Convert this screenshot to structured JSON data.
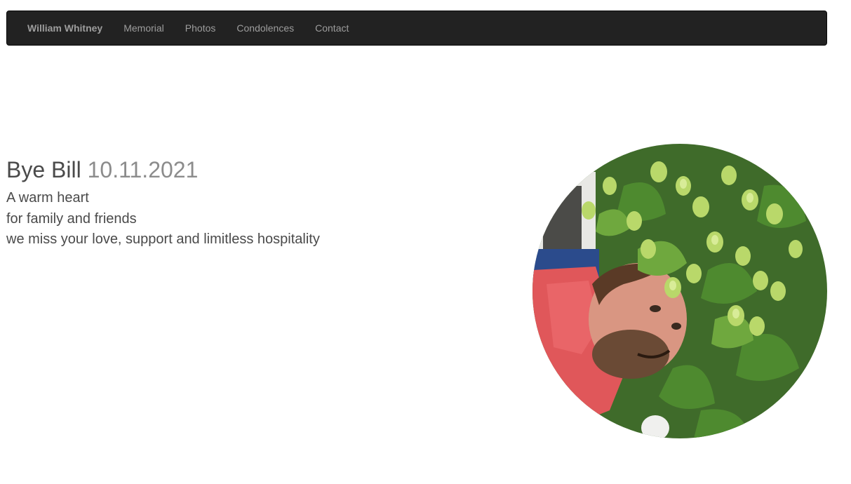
{
  "navbar": {
    "brand": "William Whitney",
    "links": [
      "Memorial",
      "Photos",
      "Condolences",
      "Contact"
    ]
  },
  "hero": {
    "title": "Bye Bill",
    "date": "10.11.2021",
    "lines": [
      "A warm heart",
      "for family and friends",
      "we miss your love, support and limitless hospitality"
    ]
  },
  "colors": {
    "navbar_bg": "#222222",
    "nav_text": "#9d9d9d",
    "body_text": "#4a4a4a",
    "date_text": "#8c8c8c"
  }
}
